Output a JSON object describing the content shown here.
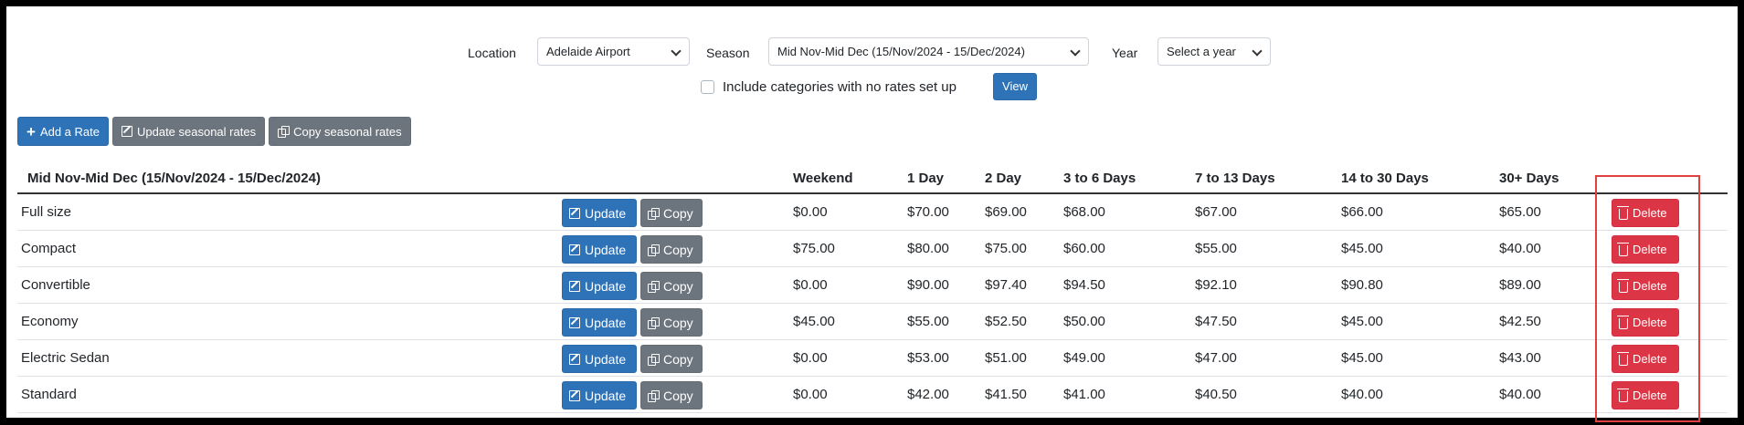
{
  "filters": {
    "location_label": "Location",
    "location_value": "Adelaide Airport",
    "season_label": "Season",
    "season_value": "Mid Nov-Mid Dec (15/Nov/2024 - 15/Dec/2024)",
    "year_label": "Year",
    "year_value": "Select a year",
    "include_label": "Include categories with no rates set up",
    "view_label": "View"
  },
  "actions": {
    "add_rate": "Add a Rate",
    "update_seasonal": "Update seasonal rates",
    "copy_seasonal": "Copy seasonal rates"
  },
  "table": {
    "title": "Mid Nov-Mid Dec (15/Nov/2024 - 15/Dec/2024)",
    "columns": [
      "Weekend",
      "1 Day",
      "2 Day",
      "3 to 6 Days",
      "7 to 13 Days",
      "14 to 30 Days",
      "30+ Days"
    ],
    "update_label": "Update",
    "copy_label": "Copy",
    "delete_label": "Delete",
    "rows": [
      {
        "name": "Full size",
        "rates": [
          "$0.00",
          "$70.00",
          "$69.00",
          "$68.00",
          "$67.00",
          "$66.00",
          "$65.00"
        ]
      },
      {
        "name": "Compact",
        "rates": [
          "$75.00",
          "$80.00",
          "$75.00",
          "$60.00",
          "$55.00",
          "$45.00",
          "$40.00"
        ]
      },
      {
        "name": "Convertible",
        "rates": [
          "$0.00",
          "$90.00",
          "$97.40",
          "$94.50",
          "$92.10",
          "$90.80",
          "$89.00"
        ]
      },
      {
        "name": "Economy",
        "rates": [
          "$45.00",
          "$55.00",
          "$52.50",
          "$50.00",
          "$47.50",
          "$45.00",
          "$42.50"
        ]
      },
      {
        "name": "Electric Sedan",
        "rates": [
          "$0.00",
          "$53.00",
          "$51.00",
          "$49.00",
          "$47.00",
          "$45.00",
          "$43.00"
        ]
      },
      {
        "name": "Standard",
        "rates": [
          "$0.00",
          "$42.00",
          "$41.50",
          "$41.00",
          "$40.50",
          "$40.00",
          "$40.00"
        ]
      }
    ]
  },
  "colors": {
    "primary": "#2e73b8",
    "secondary": "#6c757d",
    "danger": "#dc3545",
    "highlight": "#e04040"
  }
}
